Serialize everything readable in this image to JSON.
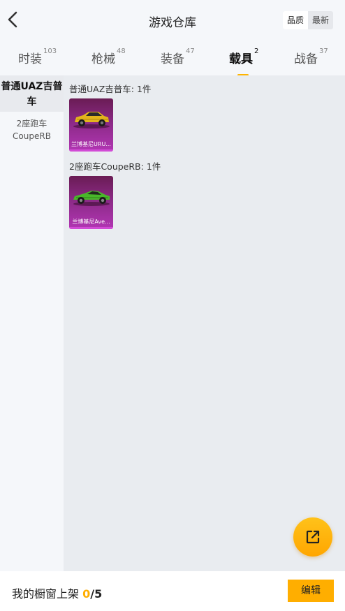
{
  "header": {
    "title": "游戏仓库",
    "sort_options": [
      "品质",
      "最新"
    ],
    "active_sort": "品质"
  },
  "tabs": [
    {
      "label": "时装",
      "count": "103"
    },
    {
      "label": "枪械",
      "count": "48"
    },
    {
      "label": "装备",
      "count": "47"
    },
    {
      "label": "载具",
      "count": "2",
      "active": true
    },
    {
      "label": "战备",
      "count": "37"
    }
  ],
  "sidebar": {
    "items": [
      {
        "label": "普通UAZ吉普车",
        "active": true
      },
      {
        "label_line1": "2座跑车",
        "label_line2": "CoupeRB"
      }
    ]
  },
  "groups": [
    {
      "title": "普通UAZ吉普车: 1件",
      "item": {
        "name": "兰博基尼URU...",
        "icon": "yellow-suv-icon",
        "color": "#e3b51c"
      }
    },
    {
      "title": "2座跑车CoupeRB: 1件",
      "item": {
        "name": "兰博基尼Ave...",
        "icon": "green-sports-car-icon",
        "color": "#49b82a"
      }
    }
  ],
  "footer": {
    "shelf_label": "我的橱窗上架",
    "shelf_current": "0",
    "shelf_separator": "/",
    "shelf_max": "5",
    "edit_label": "编辑"
  },
  "colors": {
    "accent": "#ffae00",
    "card_bg": "#8b2a86"
  }
}
